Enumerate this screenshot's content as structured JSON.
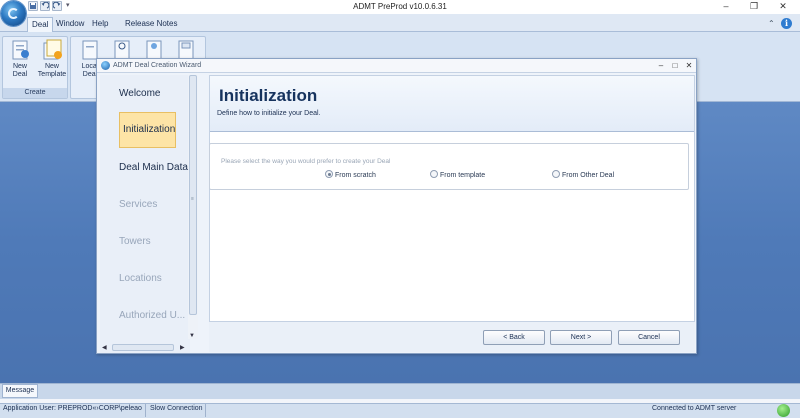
{
  "window": {
    "title": "ADMT PreProd v10.0.6.31"
  },
  "ribbon": {
    "tabs": [
      {
        "label": "Deal",
        "active": true
      },
      {
        "label": "Window"
      },
      {
        "label": "Help"
      },
      {
        "label": "Release Notes"
      }
    ],
    "groups": [
      {
        "label": "Create",
        "buttons": [
          {
            "label": "New Deal",
            "icon": "new-deal-icon"
          },
          {
            "label": "New Template",
            "icon": "new-template-icon"
          }
        ]
      },
      {
        "label": "",
        "buttons": [
          {
            "label": "Local Deal",
            "icon": "local-deal-icon"
          }
        ]
      }
    ]
  },
  "wizard": {
    "title": "ADMT Deal Creation Wizard",
    "steps": [
      {
        "label": "Welcome",
        "state": "done"
      },
      {
        "label": "Initialization",
        "state": "active"
      },
      {
        "label": "Deal Main Data",
        "state": "done"
      },
      {
        "label": "Services",
        "state": "disabled"
      },
      {
        "label": "Towers",
        "state": "disabled"
      },
      {
        "label": "Locations",
        "state": "disabled"
      },
      {
        "label": "Authorized U...",
        "state": "disabled"
      }
    ],
    "page": {
      "title": "Initialization",
      "subtitle": "Define how to initialize your Deal.",
      "prompt": "Please select the way you would prefer to create your Deal",
      "options": [
        {
          "label": "From scratch",
          "checked": true
        },
        {
          "label": "From template",
          "checked": false
        },
        {
          "label": "From Other Deal",
          "checked": false
        }
      ]
    },
    "buttons": {
      "back": "<  Back",
      "next": "Next  >",
      "cancel": "Cancel"
    }
  },
  "message_tab": "Message",
  "status": {
    "user": "Application User: PREPROD«›CORP\\peleao",
    "connection": "Slow Connection",
    "server": "Connected to ADMT server"
  },
  "colors": {
    "workspace": "#4f7ab8",
    "active_step": "#fde4a6",
    "title_text": "#16335e"
  }
}
